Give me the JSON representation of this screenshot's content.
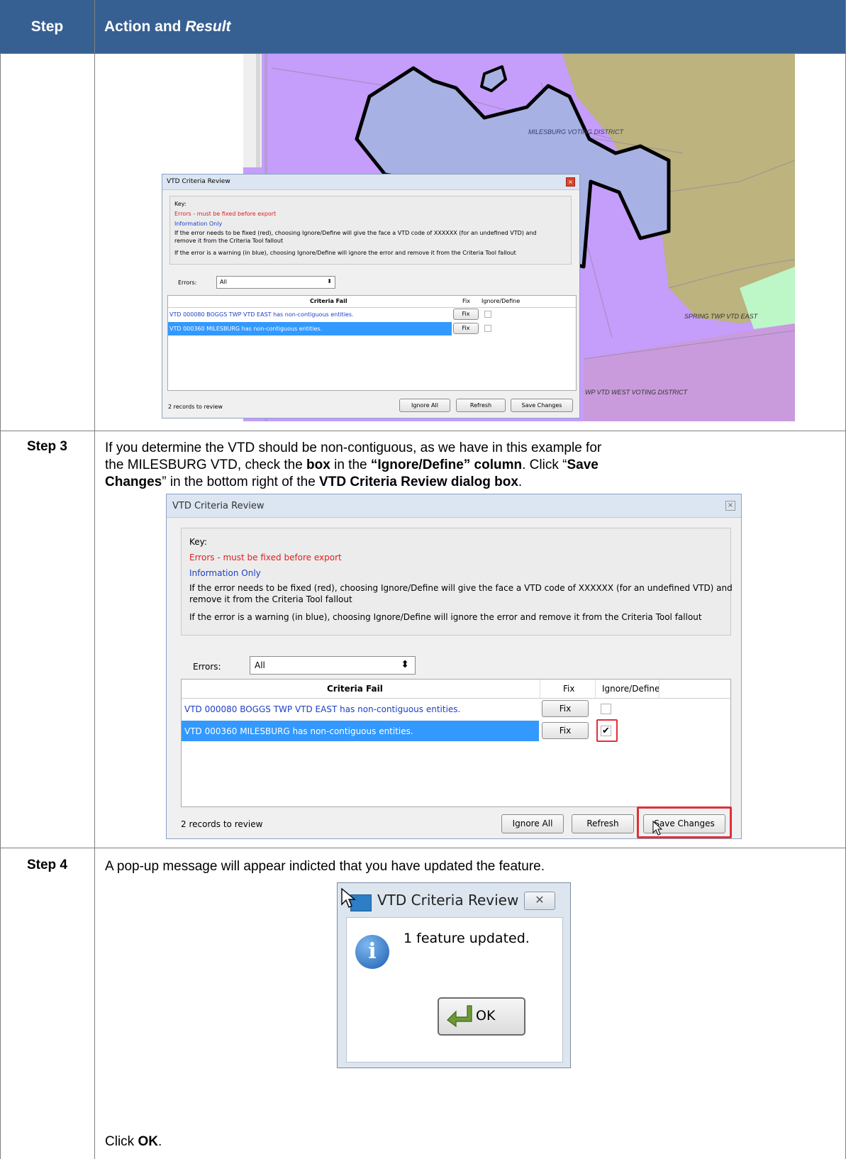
{
  "header": {
    "step": "Step",
    "action": "Action and ",
    "result": "Result"
  },
  "map": {
    "milesburg_label": "MILESBURG VOTING DISTRICT",
    "spring_label": "SPRING TWP VTD EAST",
    "west_label": "WP VTD WEST VOTING DISTRICT",
    "colors": {
      "purple": "#c59dfa",
      "olive": "#bcb37e",
      "blue_area": "#a7b1e3",
      "lavender": "#c99bdc",
      "green": "#bdf7c8"
    }
  },
  "dialog": {
    "title": "VTD Criteria Review",
    "key_label": "Key:",
    "errors_line": "Errors - must be fixed before export",
    "info_line": "Information Only",
    "note1": "If the error needs to be fixed (red), choosing Ignore/Define will give the face a VTD code of XXXXXX (for an undefined VTD) and",
    "note1b": "remove it from the Criteria Tool fallout",
    "note2": "If the error is a warning (in blue), choosing Ignore/Define will ignore the error and remove it from the Criteria Tool fallout",
    "errors_label": "Errors:",
    "errors_value": "All",
    "col_criteria": "Criteria Fail",
    "col_fix": "Fix",
    "col_ignore": "Ignore/Define",
    "rows": [
      {
        "text": "VTD 000080 BOGGS TWP VTD EAST has non-contiguous entities.",
        "fix": "Fix"
      },
      {
        "text": "VTD 000360 MILESBURG has non-contiguous entities.",
        "fix": "Fix"
      }
    ],
    "records": "2 records to review",
    "ignore_all": "Ignore All",
    "refresh": "Refresh",
    "save_changes": "Save Changes"
  },
  "step3": {
    "label": "Step 3",
    "t1": "If you determine the VTD should be non-contiguous, as we have in this example for",
    "t2a": "the MILESBURG VTD, check the ",
    "t2b": "box",
    "t2c": " in the ",
    "t2d": "“Ignore/Define” column",
    "t2e": ". Click “",
    "t2f": "Save",
    "t3a": "Changes",
    "t3b": "” in the bottom right of the ",
    "t3c": "VTD Criteria Review dialog box",
    "t3d": "."
  },
  "step4": {
    "label": "Step 4",
    "text": "A pop-up message will appear indicted that you have updated the feature.",
    "popup_title": "VTD Criteria Review",
    "popup_message": "1 feature updated.",
    "ok": "OK",
    "click_a": "Click ",
    "click_b": "OK",
    "click_c": "."
  }
}
